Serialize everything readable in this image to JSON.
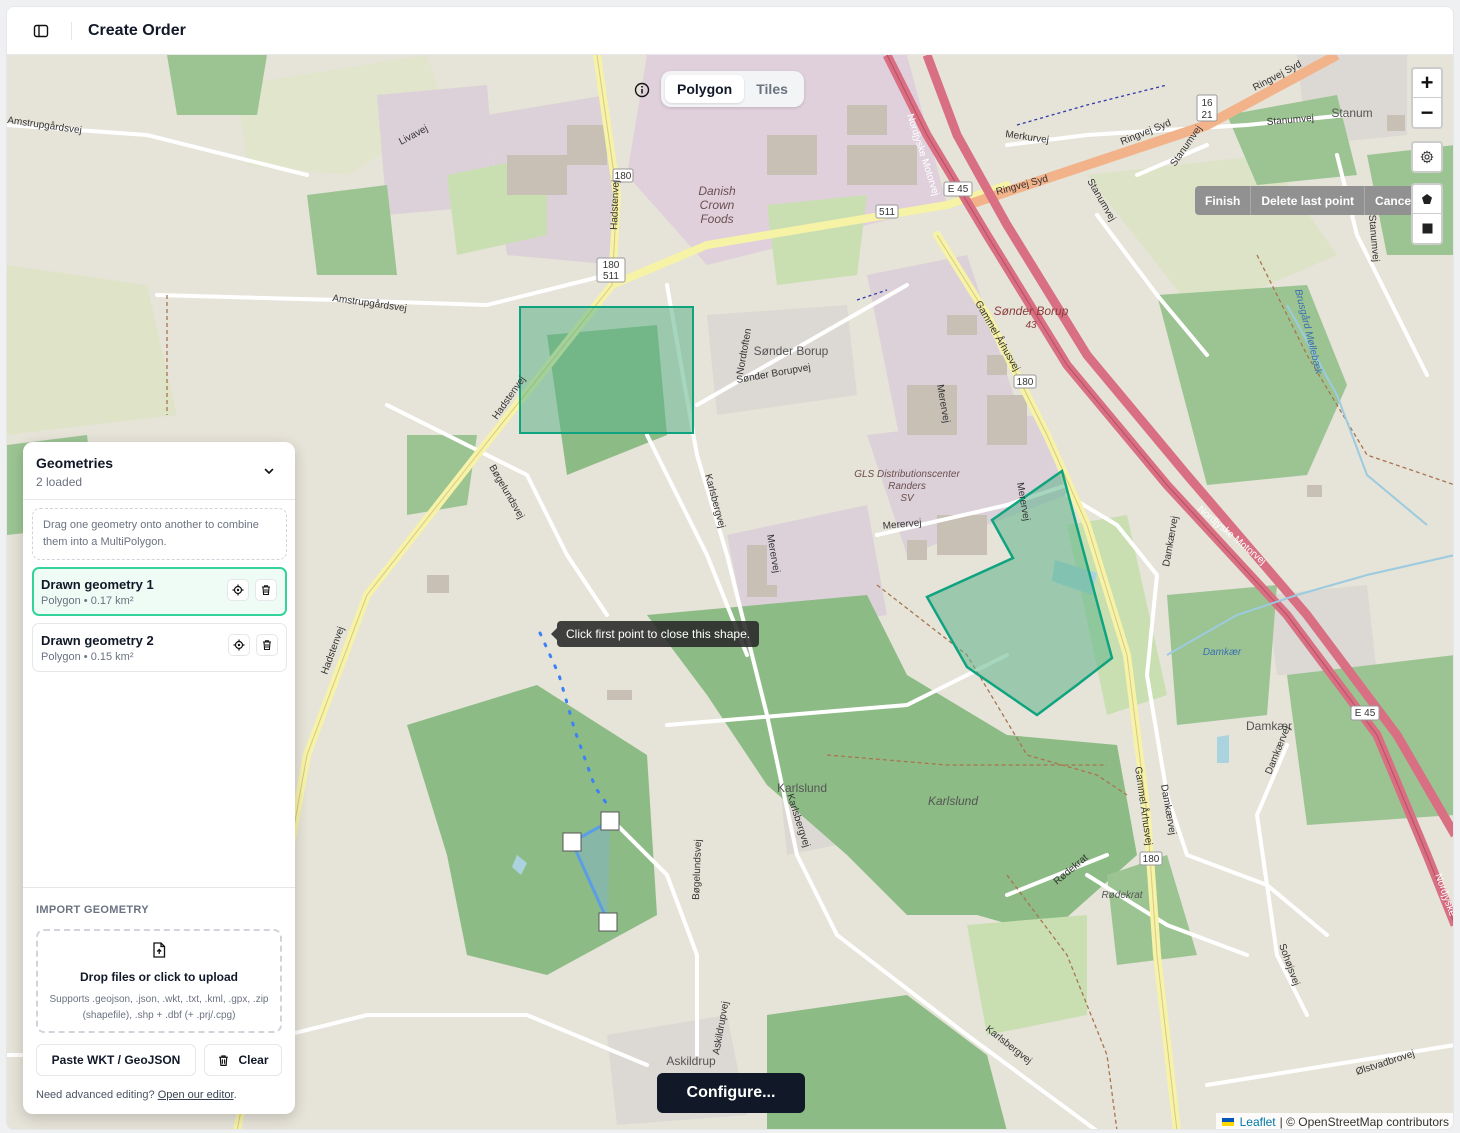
{
  "header": {
    "title": "Create Order",
    "toggle_icon": "sidebar-icon"
  },
  "mode_switch": {
    "tabs": [
      "Polygon",
      "Tiles"
    ],
    "active": "Polygon"
  },
  "map_controls": {
    "zoom_in": "+",
    "zoom_out": "−",
    "draw_actions": [
      "Finish",
      "Delete last point",
      "Cancel"
    ]
  },
  "map": {
    "tooltip": "Click first point to close this shape.",
    "labels": {
      "danish_crown_1": "Danish",
      "danish_crown_2": "Crown",
      "danish_crown_3": "Foods",
      "sonder_borup": "Sønder Borup",
      "sonder_borup_43": "Sønder Borup",
      "num_43": "43",
      "gls_1": "GLS Distributionscenter",
      "gls_2": "Randers",
      "gls_3": "SV",
      "karlslund_village": "Karlslund",
      "karlslund_forest": "Karlslund",
      "askildrup": "Askildrup",
      "damkaer_lake": "Damkær",
      "damkaer": "Damkær",
      "stanum": "Stanum",
      "radekrat": "Rødekrat",
      "nordjyske_1": "Nordjyske Motorvej",
      "nordjyske_2": "Nordjyske Motorvej",
      "nordjyske_3": "Nordjyske",
      "ringvej_1": "Ringvej Syd",
      "ringvej_2": "Ringvej Syd",
      "ringvej_3": "Ringvej Syd",
      "gammel_1": "Gammel Århusvej",
      "gammel_2": "Gammel Århusvej",
      "hadstenvej_1": "Hadstenvej",
      "hadstenvej_2": "Hadstenvej",
      "hadstenvej_3": "Hadstenvej",
      "karlsbergvej_1": "Karlsbergvej",
      "karlsbergvej_2": "Karlsbergvej",
      "karlsbergvej_3": "Karlsbergvej",
      "bogelundsvej_1": "Bøgelundsvej",
      "bogelundsvej_2": "Bøgelundsvej",
      "amstrup": "Amstrupgårdsvej",
      "amstrup_left": "Amstrupgårdsvej",
      "livavej": "Livavej",
      "merkurvej": "Merkurvej",
      "stanumvej_1": "Stanumvej",
      "stanumvej_2": "Stanumvej",
      "stanumvej_3": "Stanumvej",
      "stanumvej_4": "Stanumvej",
      "merervej_1": "Merervej",
      "merervej_2": "Merervej",
      "merervej_3": "Merervej",
      "merervej_4": "Merervej",
      "damkaervej_1": "Damkærvej",
      "damkaervej_2": "Damkærvej",
      "damkaervej_3": "Damkærvej",
      "radekrat_road": "Rødekrat",
      "sohoj": "Sohøjsvej",
      "olstrup": "Ølstvadbrovej",
      "askildrupvej": "Askildrupvej",
      "brusgard": "Brusgård Møllebæk",
      "nordtoften": "Nordtoften",
      "sonder_borupvej": "Sønder Borupvej",
      "sedsvej": "Stanumvej",
      "route_180_a": "180",
      "route_511_a": "511",
      "route_180_b": "180",
      "route_180_c": "180",
      "route_180_d": "180",
      "route_511_b": "511",
      "route_e45_a": "E 45",
      "route_e45_b": "E 45",
      "route_16": "16",
      "route_21": "21"
    }
  },
  "panel": {
    "title": "Geometries",
    "subtitle": "2 loaded",
    "hint": "Drag one geometry onto another to combine them into a MultiPolygon.",
    "geometries": [
      {
        "name": "Drawn geometry 1",
        "meta": "Polygon • 0.17 km²",
        "selected": true
      },
      {
        "name": "Drawn geometry 2",
        "meta": "Polygon • 0.15 km²",
        "selected": false
      }
    ],
    "import": {
      "title": "IMPORT GEOMETRY",
      "drop_title": "Drop files or click to upload",
      "drop_sub": "Supports .geojson, .json, .wkt, .txt, .kml, .gpx, .zip (shapefile), .shp + .dbf (+ .prj/.cpg)",
      "paste_button": "Paste WKT / GeoJSON",
      "clear_button": "Clear",
      "footer_prefix": "Need advanced editing?",
      "footer_link": "Open our editor",
      "footer_suffix": "."
    }
  },
  "configure_button": "Configure...",
  "attribution": {
    "leaflet": "Leaflet",
    "rest": "| © OpenStreetMap contributors"
  },
  "colors": {
    "accent_green": "#10a37f",
    "polygon_fill": "#5fb58a",
    "primary_dark": "#111827",
    "motorway": "#d96f82",
    "trunk": "#f2b38a"
  }
}
